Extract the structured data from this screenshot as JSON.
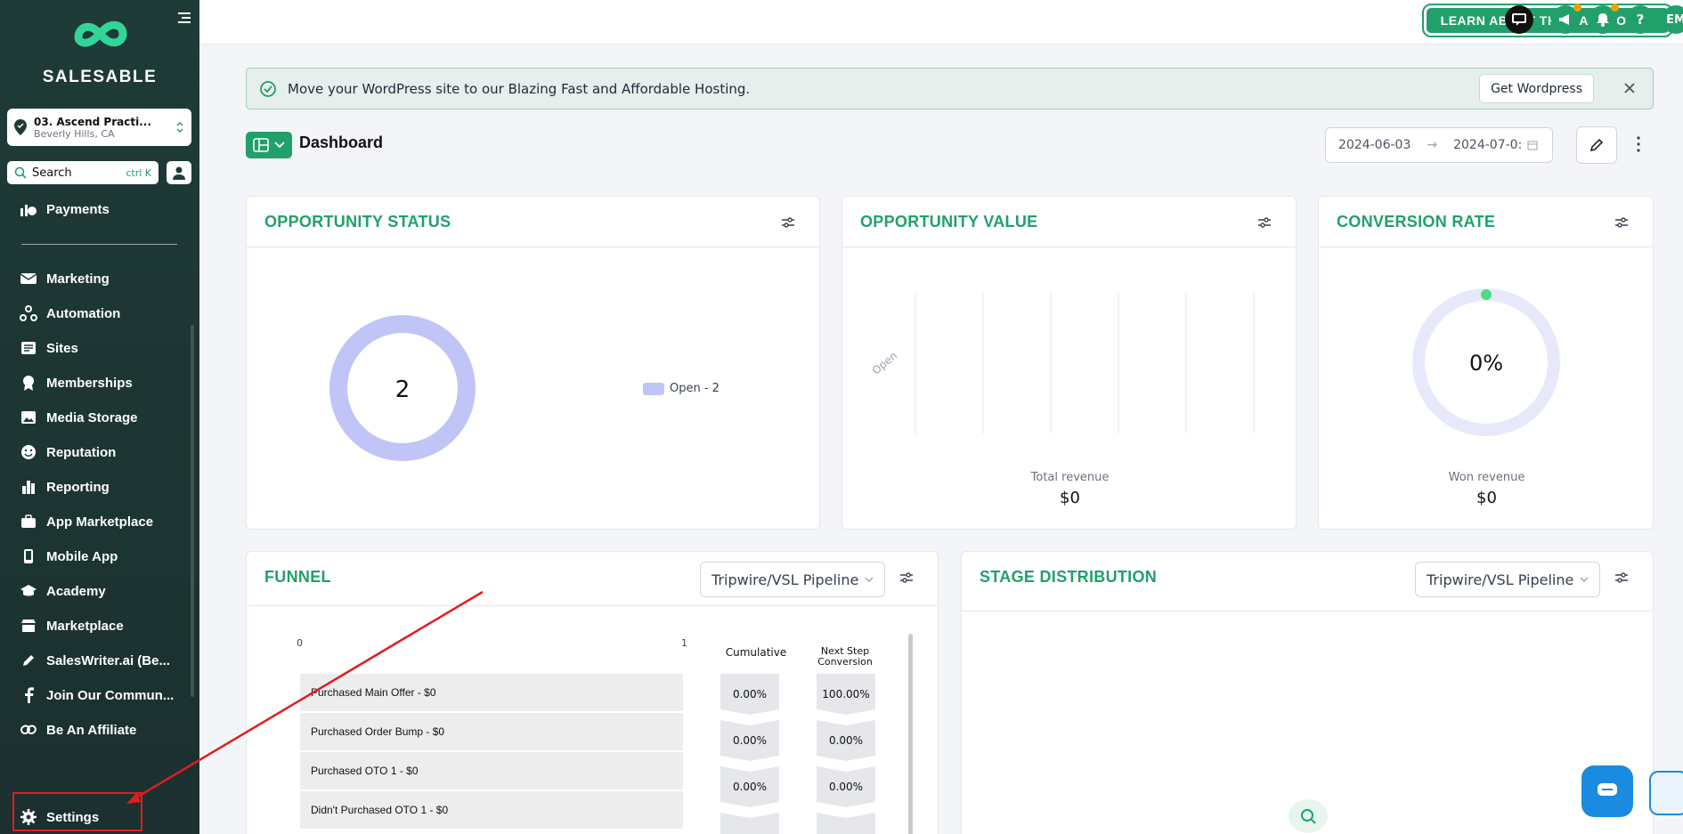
{
  "brand": {
    "name": "SALESABLE"
  },
  "location": {
    "name": "03. Ascend Practi...",
    "city": "Beverly Hills, CA"
  },
  "search": {
    "label": "Search",
    "shortcut": "ctrl K"
  },
  "sidebar": {
    "items": [
      {
        "label": "Payments",
        "icon": "payments-icon"
      },
      {
        "label": "Marketing",
        "icon": "marketing-icon"
      },
      {
        "label": "Automation",
        "icon": "automation-icon"
      },
      {
        "label": "Sites",
        "icon": "sites-icon"
      },
      {
        "label": "Memberships",
        "icon": "memberships-icon"
      },
      {
        "label": "Media Storage",
        "icon": "media-icon"
      },
      {
        "label": "Reputation",
        "icon": "reputation-icon"
      },
      {
        "label": "Reporting",
        "icon": "reporting-icon"
      },
      {
        "label": "App Marketplace",
        "icon": "app-marketplace-icon"
      },
      {
        "label": "Mobile App",
        "icon": "mobile-icon"
      },
      {
        "label": "Academy",
        "icon": "academy-icon"
      },
      {
        "label": "Marketplace",
        "icon": "marketplace-icon"
      },
      {
        "label": "SalesWriter.ai (Be...",
        "icon": "pencil-icon"
      },
      {
        "label": "Join Our Commun...",
        "icon": "facebook-icon"
      },
      {
        "label": "Be An Affiliate",
        "icon": "link-icon"
      }
    ],
    "settings": "Settings"
  },
  "topbar": {
    "learn_button": "LEARN ABOUT THE DASHBOARD",
    "avatar_initials": "EM"
  },
  "banner": {
    "text": "Move your WordPress site to our Blazing Fast and Affordable Hosting.",
    "button": "Get Wordpress"
  },
  "dashboard": {
    "title": "Dashboard",
    "date_start": "2024-06-03",
    "date_end": "2024-07-0:"
  },
  "cards": {
    "opportunity_status": {
      "title": "OPPORTUNITY STATUS",
      "center_value": "2",
      "legend": "Open - 2"
    },
    "opportunity_value": {
      "title": "OPPORTUNITY VALUE",
      "total_label": "Total revenue",
      "total_value": "$0"
    },
    "conversion_rate": {
      "title": "CONVERSION RATE",
      "center_value": "0%",
      "won_label": "Won revenue",
      "won_value": "$0"
    },
    "funnel": {
      "title": "FUNNEL",
      "pipeline": "Tripwire/VSL Pipeline",
      "axis_start": "0",
      "axis_end": "1",
      "col_cumulative": "Cumulative",
      "col_next_1": "Next Step",
      "col_next_2": "Conversion",
      "rows": [
        {
          "label": "Purchased Main Offer - $0",
          "cumulative": "0.00%",
          "next": "100.00%"
        },
        {
          "label": "Purchased Order Bump - $0",
          "cumulative": "0.00%",
          "next": "0.00%"
        },
        {
          "label": "Purchased OTO 1 - $0",
          "cumulative": "0.00%",
          "next": "0.00%"
        },
        {
          "label": "Didn't Purchased OTO 1 - $0"
        }
      ]
    },
    "stage_distribution": {
      "title": "STAGE DISTRIBUTION",
      "pipeline": "Tripwire/VSL Pipeline"
    }
  },
  "chart_data": [
    {
      "type": "pie",
      "categories": [
        "Open"
      ],
      "values": [
        2
      ],
      "title": "OPPORTUNITY STATUS",
      "legend": [
        "Open - 2"
      ],
      "colors": [
        "#c1c4f6"
      ]
    },
    {
      "type": "bar",
      "title": "OPPORTUNITY VALUE",
      "categories": [
        "Open"
      ],
      "values": [
        0
      ],
      "xticks": [
        "$0",
        "$0.2",
        "$0.4",
        "$0.6",
        "$0.8",
        "$1"
      ],
      "xlim": [
        0,
        1
      ],
      "xlabel": "Total revenue"
    }
  ],
  "colors": {
    "accent": "#22a06b",
    "sidebar": "#1f3b38",
    "donut": "#c1c4f6",
    "gauge_track": "#e7e9fb"
  }
}
